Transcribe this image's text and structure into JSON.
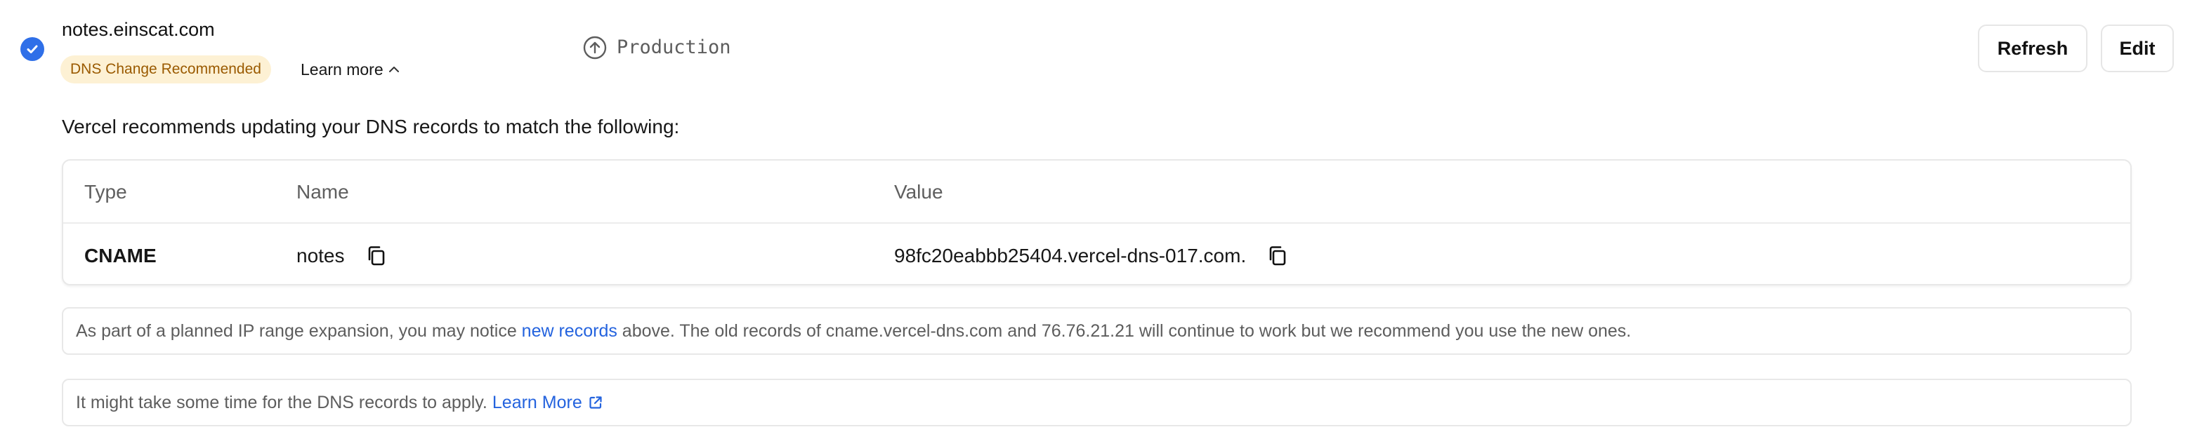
{
  "domain": {
    "name": "notes.einscat.com",
    "status_badge": "DNS Change Recommended",
    "learn_more": "Learn more",
    "environment": "Production",
    "verified_icon": "check-circle-icon"
  },
  "actions": {
    "refresh_label": "Refresh",
    "edit_label": "Edit"
  },
  "recommendation": {
    "text": "Vercel recommends updating your DNS records to match the following:"
  },
  "dns_table": {
    "headers": {
      "type": "Type",
      "name": "Name",
      "value": "Value"
    },
    "rows": [
      {
        "type": "CNAME",
        "name": "notes",
        "value": "98fc20eabbb25404.vercel-dns-017.com."
      }
    ]
  },
  "notices": {
    "ip_expansion": {
      "before": "As part of a planned IP range expansion, you may notice ",
      "link": "new records",
      "after": " above. The old records of cname.vercel-dns.com and 76.76.21.21 will continue to work but we recommend you use the new ones."
    },
    "propagation": {
      "text": "It might take some time for the DNS records to apply.",
      "link": "Learn More"
    }
  },
  "colors": {
    "accent_blue": "#2f6fe8",
    "link_blue": "#2463de",
    "badge_bg": "#fdf1d4",
    "badge_text": "#9a5a00",
    "border": "#e8e8e8"
  }
}
